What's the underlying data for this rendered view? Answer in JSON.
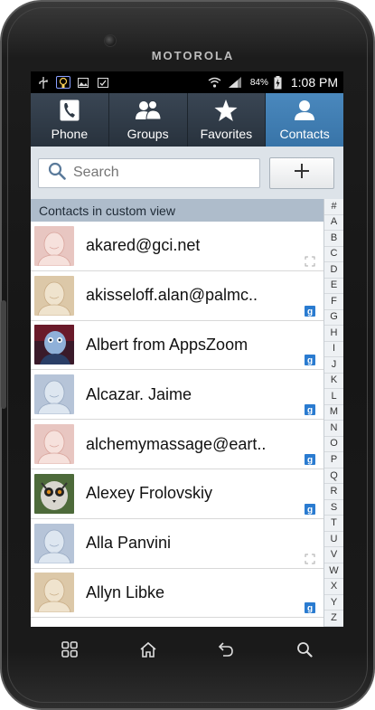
{
  "device": {
    "brand": "MOTOROLA"
  },
  "statusbar": {
    "battery_percent": "84%",
    "time": "1:08 PM",
    "icons": [
      "usb-icon",
      "lightbulb-icon",
      "image-icon",
      "calendar-icon",
      "wifi-icon",
      "signal-icon",
      "battery-icon"
    ]
  },
  "tabs": [
    {
      "label": "Phone",
      "icon": "phone-icon",
      "active": false
    },
    {
      "label": "Groups",
      "icon": "groups-icon",
      "active": false
    },
    {
      "label": "Favorites",
      "icon": "star-icon",
      "active": false
    },
    {
      "label": "Contacts",
      "icon": "person-icon",
      "active": true
    }
  ],
  "search": {
    "placeholder": "Search",
    "value": "",
    "add_icon": "plus-icon"
  },
  "list": {
    "header": "Contacts in custom view",
    "contacts": [
      {
        "name": "akared@gci.net",
        "avatar": "default-avatar-pink",
        "badge": "phone-contact-icon"
      },
      {
        "name": "akisseloff.alan@palmc..",
        "avatar": "default-avatar-tan",
        "badge": "google-icon"
      },
      {
        "name": "Albert from AppsZoom",
        "avatar": "photo-avatar-robot",
        "badge": "google-icon"
      },
      {
        "name": "Alcazar. Jaime",
        "avatar": "default-avatar-blue",
        "badge": "google-icon"
      },
      {
        "name": "alchemymassage@eart..",
        "avatar": "default-avatar-pink",
        "badge": "google-icon"
      },
      {
        "name": "Alexey Frolovskiy",
        "avatar": "photo-avatar-lemur",
        "badge": "google-icon"
      },
      {
        "name": "Alla Panvini",
        "avatar": "default-avatar-blue",
        "badge": "phone-contact-icon"
      },
      {
        "name": "Allyn Libke",
        "avatar": "default-avatar-tan",
        "badge": "google-icon"
      }
    ]
  },
  "index_letters": [
    "#",
    "A",
    "B",
    "C",
    "D",
    "E",
    "F",
    "G",
    "H",
    "I",
    "J",
    "K",
    "L",
    "M",
    "N",
    "O",
    "P",
    "Q",
    "R",
    "S",
    "T",
    "U",
    "V",
    "W",
    "X",
    "Y",
    "Z"
  ],
  "navbar": [
    "home-grid-icon",
    "home-icon",
    "back-icon",
    "search-icon"
  ],
  "colors": {
    "active_tab": "#3f7db2",
    "tab_bg": "#2f3a46",
    "section_header": "#aebccb",
    "google_badge": "#2a7bd0"
  }
}
